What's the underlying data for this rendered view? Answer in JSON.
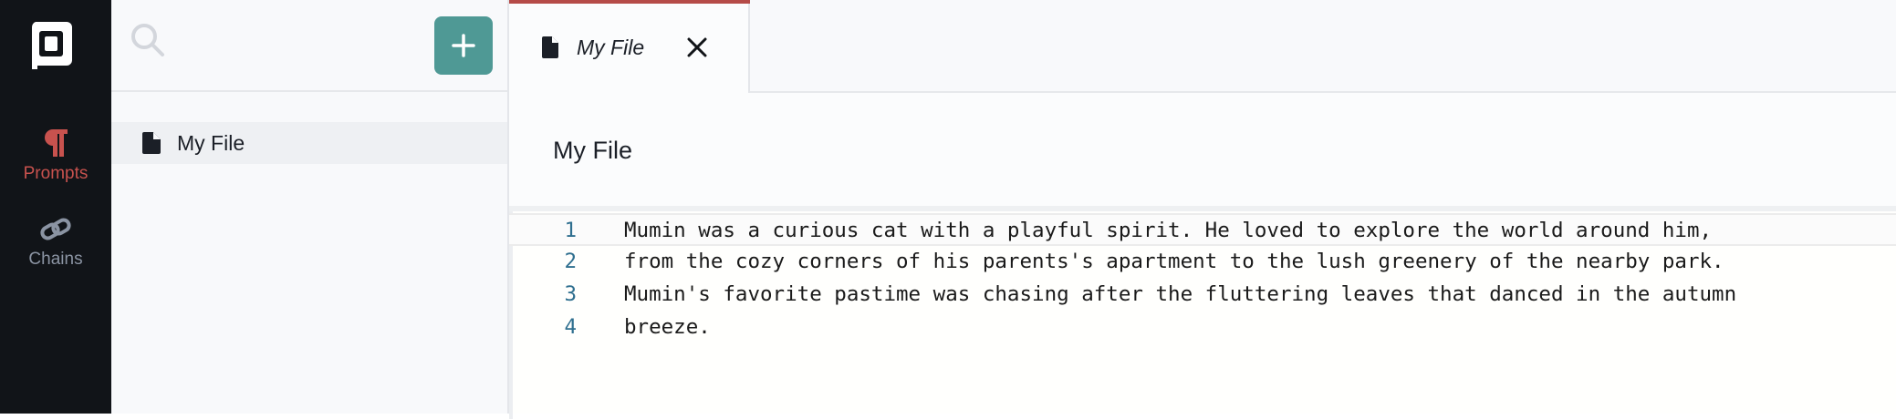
{
  "nav": {
    "logo": "app-logo",
    "items": [
      {
        "label": "Prompts",
        "icon": "pilcrow-icon",
        "active": true,
        "color": "#c8524e"
      },
      {
        "label": "Chains",
        "icon": "link-icon",
        "active": false,
        "color": "#8b94a3"
      }
    ]
  },
  "sidebar": {
    "search_icon": "search-icon",
    "add_icon": "plus-icon",
    "add_color": "#4f9995",
    "files": [
      {
        "label": "My File",
        "icon": "file-icon",
        "selected": true
      }
    ]
  },
  "tabs": [
    {
      "label": "My File",
      "icon": "file-icon",
      "active": true,
      "accent": "#b54b48",
      "close_icon": "close-icon"
    }
  ],
  "document": {
    "title": "My File",
    "lines": [
      {
        "number": "1",
        "text": "Mumin was a curious cat with a playful spirit. He loved to explore the world around him,"
      },
      {
        "number": "2",
        "text": "from the cozy corners of his parents's apartment to the lush greenery of the nearby park."
      },
      {
        "number": "3",
        "text": "Mumin's favorite pastime was chasing after the fluttering leaves that danced in the autumn"
      },
      {
        "number": "4",
        "text": "breeze."
      }
    ]
  }
}
